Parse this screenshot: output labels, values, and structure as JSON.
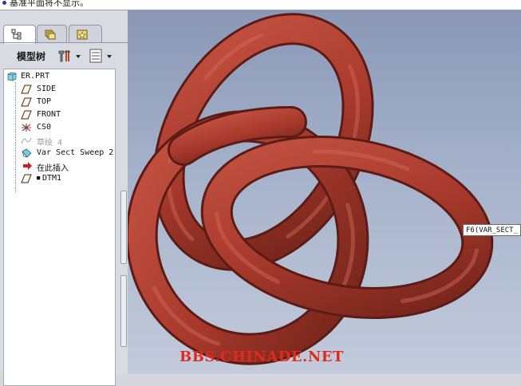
{
  "message_bar": {
    "text": "基准平面将不显示。"
  },
  "left_panel": {
    "tabs": [
      {
        "icon": "model-tree-tab-icon",
        "active": true
      },
      {
        "icon": "folder-browser-tab-icon",
        "active": false
      },
      {
        "icon": "favorites-tab-icon",
        "active": false
      }
    ],
    "toolbar": {
      "title": "模型树"
    },
    "tree": {
      "root": "ER.PRT",
      "items": [
        {
          "label": "SIDE",
          "icon": "datum-plane-icon"
        },
        {
          "label": "TOP",
          "icon": "datum-plane-icon"
        },
        {
          "label": "FRONT",
          "icon": "datum-plane-icon"
        },
        {
          "label": "CS0",
          "icon": "coordinate-system-icon"
        },
        {
          "label": "草绘 4",
          "icon": "sketch-icon",
          "dimmed": true
        },
        {
          "label": "Var Sect Sweep 2",
          "icon": "variable-section-sweep-icon"
        },
        {
          "label": "在此插入",
          "icon": "insert-here-arrow-icon"
        },
        {
          "label": "DTM1",
          "icon": "datum-plane-icon",
          "marker": "■"
        }
      ]
    }
  },
  "viewport": {
    "tooltip": "F6(VAR_SECT_",
    "model_color": "#a8392c",
    "watermark": "BBS.CHINADE.NET"
  },
  "colors": {
    "viewport_background_top": "#8a98b6",
    "viewport_background_bottom": "#c3cbdc",
    "watermark": "#e02a1f"
  }
}
